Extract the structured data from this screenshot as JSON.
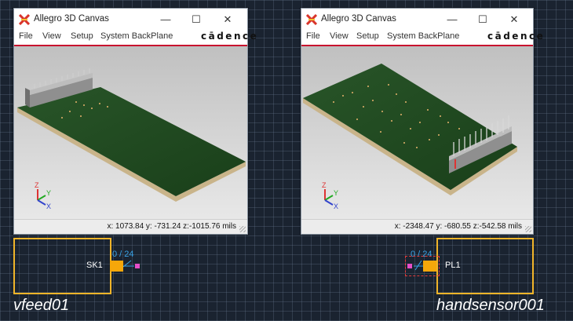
{
  "windows": [
    {
      "title": "Allegro 3D Canvas",
      "menu": [
        "File",
        "View",
        "Setup",
        "System BackPlane"
      ],
      "brand": "cādence",
      "status": "x: 1073.84 y: -731.24 z:-1015.76 mils"
    },
    {
      "title": "Allegro 3D Canvas",
      "menu": [
        "File",
        "View",
        "Setup",
        "System BackPlane"
      ],
      "brand": "cādence",
      "status": "x: -2348.47 y: -680.55 z:-542.58 mils"
    }
  ],
  "window_controls": {
    "minimize": "—",
    "maximize": "☐",
    "close": "✕"
  },
  "axes": {
    "x": "X",
    "y": "Y",
    "z": "Z"
  },
  "blocks": [
    {
      "ref": "SK1",
      "ports": "0 / 24",
      "instance": "vfeed01"
    },
    {
      "ref": "PL1",
      "ports": "0 / 24",
      "instance": "handsensor001"
    }
  ],
  "colors": {
    "block_border": "#f0b429",
    "port": "#f5a70a",
    "port_count": "#3aa4e8",
    "pin": "#e64ec8",
    "board_green": "#1f4a1f",
    "brand_line": "#c8102e"
  },
  "icons": {
    "app": "allegro-logo-icon"
  }
}
